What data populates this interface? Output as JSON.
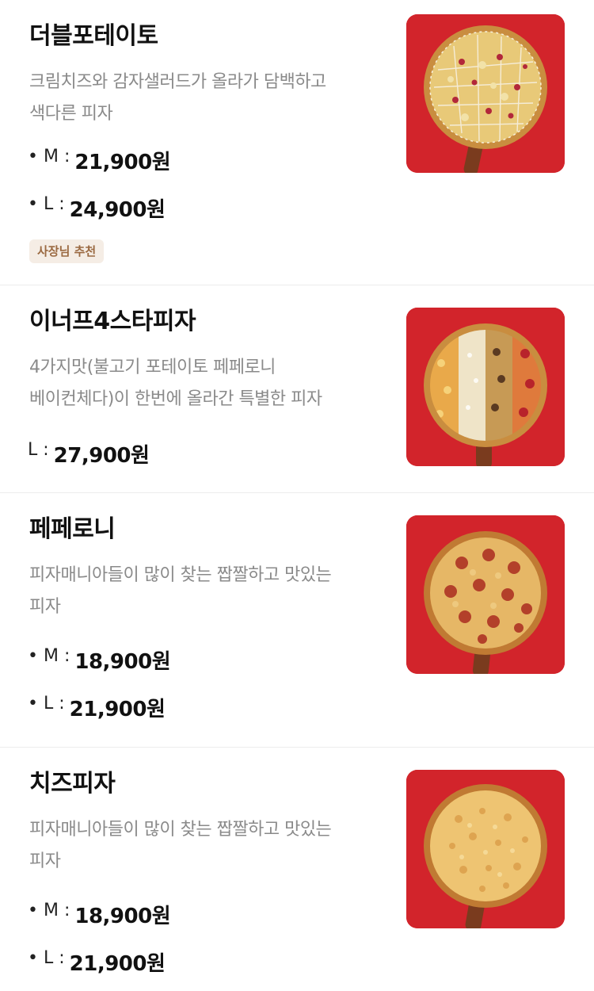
{
  "menu": {
    "items": [
      {
        "name": "더블포테이토",
        "desc_line1": "크림치즈와 감자샐러드가 올라가 담백하고",
        "desc_line2": "색다른 피자",
        "prices": [
          {
            "label": "• M :",
            "value": "21,900원"
          },
          {
            "label": "• L :",
            "value": "24,900원"
          }
        ],
        "badge": "사장님 추천",
        "image": "double-potato-pizza-photo"
      },
      {
        "name": "이너프4스타피자",
        "desc_line1": "4가지맛(불고기 포테이토 페페로니",
        "desc_line2": "베이컨체다)이 한번에 올라간 특별한 피자",
        "prices": [
          {
            "label": "L :",
            "value": "27,900원"
          }
        ],
        "image": "four-star-pizza-photo"
      },
      {
        "name": "페페로니",
        "desc_line1": "피자매니아들이 많이 찾는 짭짤하고 맛있는",
        "desc_line2": "피자",
        "prices": [
          {
            "label": "• M :",
            "value": "18,900원"
          },
          {
            "label": "• L :",
            "value": "21,900원"
          }
        ],
        "image": "pepperoni-pizza-photo"
      },
      {
        "name": "치즈피자",
        "desc_line1": "피자매니아들이 많이 찾는 짭짤하고 맛있는",
        "desc_line2": "피자",
        "prices": [
          {
            "label": "• M :",
            "value": "18,900원"
          },
          {
            "label": "• L :",
            "value": "21,900원"
          }
        ],
        "image": "cheese-pizza-photo"
      }
    ]
  },
  "colors": {
    "thumb_background": "#d2242b",
    "badge_background": "#f5ede5",
    "badge_text": "#9b6a42",
    "description_text": "#8a8a8a"
  }
}
